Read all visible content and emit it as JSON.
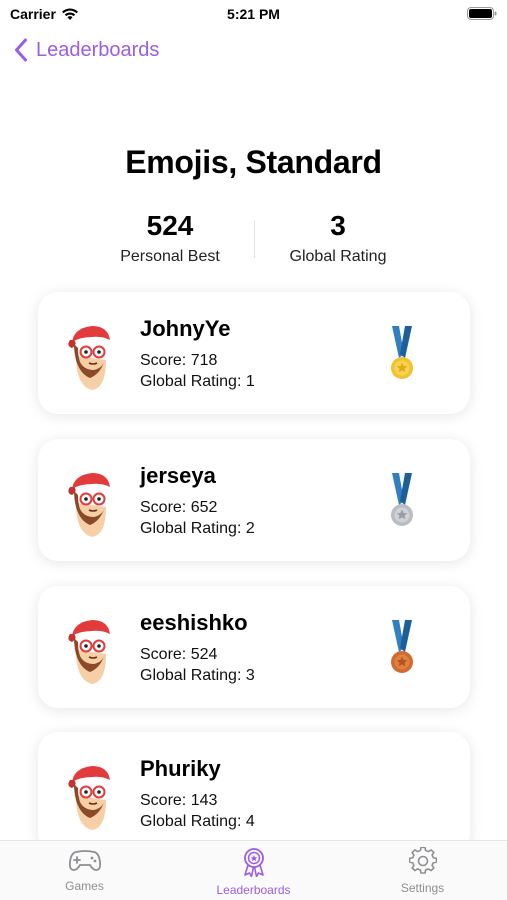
{
  "status_bar": {
    "carrier": "Carrier",
    "time": "5:21 PM"
  },
  "nav": {
    "back_label": "Leaderboards"
  },
  "header": {
    "title": "Emojis, Standard"
  },
  "stats": {
    "personal_best_value": "524",
    "personal_best_label": "Personal Best",
    "global_rating_value": "3",
    "global_rating_label": "Global Rating"
  },
  "entries": [
    {
      "name": "JohnyYe",
      "score": "Score: 718",
      "rating": "Global Rating: 1",
      "medal": "gold"
    },
    {
      "name": "jerseya",
      "score": "Score: 652",
      "rating": "Global Rating: 2",
      "medal": "silver"
    },
    {
      "name": "eeshishko",
      "score": "Score: 524",
      "rating": "Global Rating: 3",
      "medal": "bronze"
    },
    {
      "name": "Phuriky",
      "score": "Score: 143",
      "rating": "Global Rating: 4",
      "medal": "none"
    }
  ],
  "tabs": [
    {
      "label": "Games",
      "icon": "gamepad-icon",
      "active": false
    },
    {
      "label": "Leaderboards",
      "icon": "award-ribbon-icon",
      "active": true
    },
    {
      "label": "Settings",
      "icon": "gear-icon",
      "active": false
    }
  ],
  "colors": {
    "accent": "#9b5de5",
    "ribbon": "#2f7fc1",
    "gold": "#f2c12e",
    "silver": "#b9bcc2",
    "bronze": "#d2692e"
  }
}
